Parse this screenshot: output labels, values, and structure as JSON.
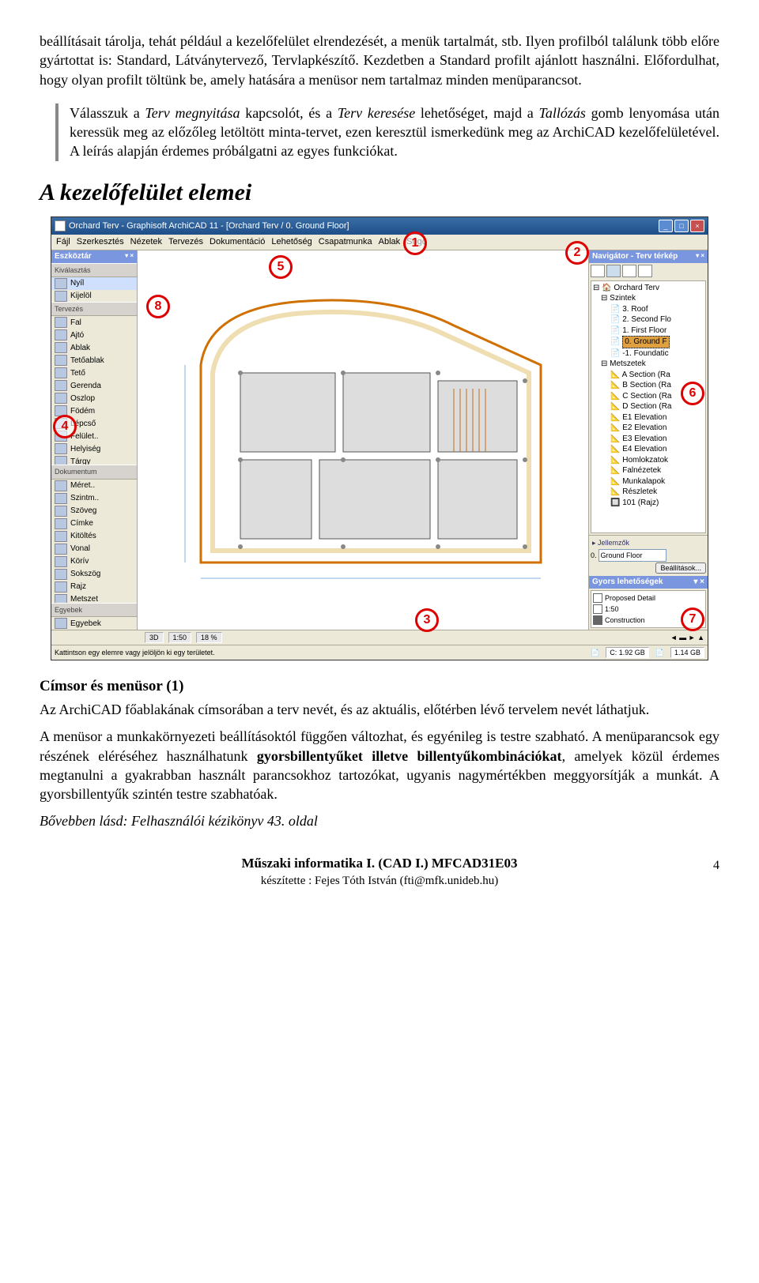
{
  "para1": "beállításait tárolja, tehát például a kezelőfelület elrendezését, a menük tartalmát, stb. Ilyen profilból találunk több előre gyártottat is: Standard, Látványtervező, Tervlapkészítő. Kezdetben a Standard profilt ajánlott használni. Előfordulhat, hogy olyan profilt töltünk be, amely hatására a menüsor nem tartalmaz minden menüparancsot.",
  "quote_prefix": "Válasszuk a ",
  "quote_italic1": "Terv megnyitása",
  "quote_mid1": " kapcsolót, és a ",
  "quote_italic2": "Terv keresése",
  "quote_mid2": " lehetőséget, majd a ",
  "quote_italic3": "Tallózás",
  "quote_suffix": " gomb lenyomása után keressük meg az előzőleg letöltött minta-tervet, ezen keresztül ismerkedünk meg az ArchiCAD kezelőfelületével. A leírás alapján érdemes próbálgatni az egyes funkciókat.",
  "section_title": "A kezelőfelület elemei",
  "app": {
    "title": "Orchard Terv - Graphisoft ArchiCAD 11 - [Orchard Terv / 0. Ground Floor]",
    "menus": [
      "Fájl",
      "Szerkesztés",
      "Nézetek",
      "Tervezés",
      "Dokumentáció",
      "Lehetőség",
      "Csapatmunka",
      "Ablak",
      "Súgó"
    ],
    "toolbox": {
      "title": "Eszköztár",
      "sec1": "Kiválasztás",
      "items1": [
        "Nyíl",
        "Kijelöl"
      ],
      "sec2": "Tervezés",
      "items2": [
        "Fal",
        "Ajtó",
        "Ablak",
        "Tetőablak",
        "Tető",
        "Gerenda",
        "Oszlop",
        "Födém",
        "Lépcső",
        "Felület..",
        "Helyiség",
        "Tárgy"
      ],
      "sec3": "Dokumentum",
      "items3": [
        "Méret..",
        "Szintm..",
        "Szöveg",
        "Címke",
        "Kitöltés",
        "Vonal",
        "Körív",
        "Sokszög",
        "Rajz",
        "Metszet"
      ],
      "sec4": "Egyebek",
      "items4": [
        "Egyebek"
      ]
    },
    "navigator": {
      "title": "Navigátor - Terv térkép",
      "root": "Orchard Terv",
      "levels_label": "Szintek",
      "levels": [
        "3. Roof",
        "2. Second Flo",
        "1. First Floor",
        "0. Ground F",
        "-1. Foundatic"
      ],
      "sections_label": "Metszetek",
      "sections": [
        "A Section (Ra",
        "B Section (Ra",
        "C Section (Ra",
        "D Section (Ra",
        "E1 Elevation",
        "E2 Elevation",
        "E3 Elevation",
        "E4 Elevation",
        "Homlokzatok",
        "Falnézetek",
        "Munkalapok",
        "Részletek"
      ],
      "extra": "101 (Rajz)",
      "props_label": "Jellemzők",
      "prop_id": "0.",
      "prop_name": "Ground Floor",
      "prop_settings": "Beállítások..."
    },
    "quick": {
      "title": "Gyors lehetőségek",
      "items": [
        "Proposed Detail",
        "1:50",
        "Construction"
      ]
    },
    "bottombar": {
      "mode": "3D",
      "scale": "1:50",
      "zoom": "18 %"
    },
    "status": {
      "msg": "Kattintson egy elemre vagy jelöljön ki egy területet.",
      "c": "C: 1.92 GB",
      "d": "1.14 GB"
    }
  },
  "badges": {
    "1": "1",
    "2": "2",
    "3": "3",
    "4": "4",
    "5": "5",
    "6": "6",
    "7": "7",
    "8": "8"
  },
  "h3_1": "Címsor és menüsor (1)",
  "para2": "Az ArchiCAD főablakának címsorában a terv nevét, és az aktuális, előtérben lévő tervelem nevét láthatjuk.",
  "para3a": "A menüsor a munkakörnyezeti beállításoktól függően változhat, és egyénileg is testre szabható. A menüparancsok egy részének eléréséhez használhatunk ",
  "para3b": "gyorsbillentyűket illetve billentyűkombinációkat",
  "para3c": ", amelyek közül érdemes megtanulni a gyakrabban használt parancsokhoz tartozókat, ugyanis nagymértékben meggyorsítják a munkát. A gyorsbillentyűk szintén testre szabhatóak.",
  "para4": "Bővebben lásd: Felhasználói kézikönyv 43. oldal",
  "footer1": "Műszaki informatika I. (CAD I.)  MFCAD31E03",
  "footer2": "készítette : Fejes Tóth István (fti@mfk.unideb.hu)",
  "pagenum": "4"
}
